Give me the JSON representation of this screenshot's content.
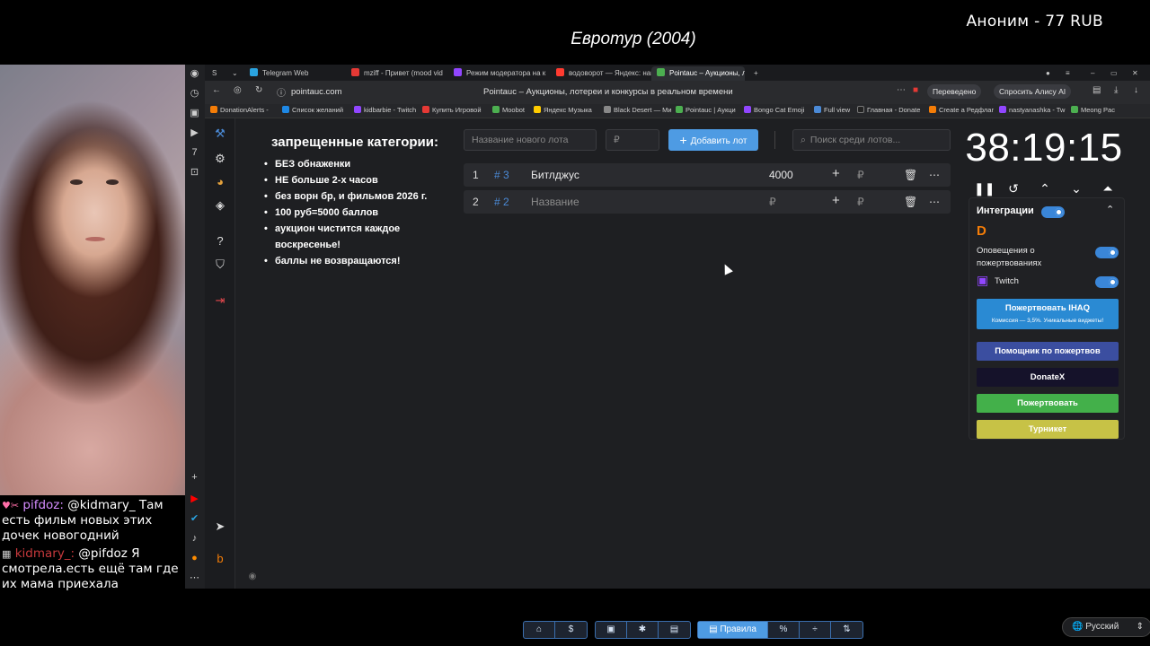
{
  "overlay": {
    "donor_line": "Аноним - 77 RUB",
    "video_title": "Евротур (2004)"
  },
  "chat": [
    {
      "user": "pifdoz:",
      "text": "@kidmary_ Там есть фильм новых этих дочек новогодний"
    },
    {
      "user": "kidmary_:",
      "text": "@pifdoz Я смотрела.есть ещё там где их мама приехала"
    }
  ],
  "browser": {
    "tabs": [
      {
        "label": "Telegram Web",
        "color": "#2aa3e0"
      },
      {
        "label": "mziff - Привет (mood vid",
        "color": "#e53935"
      },
      {
        "label": "Режим модератора на к",
        "color": "#9146ff"
      },
      {
        "label": "водоворот — Яндекс: нашл",
        "color": "#ff3b30"
      },
      {
        "label": "Pointauc – Аукционы, л",
        "color": "#4caf50"
      }
    ],
    "url": "pointauc.com",
    "page_title": "Pointauc – Аукционы, лотереи и конкурсы в реальном времени",
    "translated_label": "Переведено",
    "ask_alice_label": "Спросить Алису AI",
    "bookmarks": [
      {
        "label": "DonationAlerts -",
        "color": "#f57d07"
      },
      {
        "label": "Список желаний",
        "color": "#1e88e5"
      },
      {
        "label": "kidbarbie - Twitch",
        "color": "#9146ff"
      },
      {
        "label": "Купить Игровой",
        "color": "#e53935"
      },
      {
        "label": "Moobot",
        "color": "#4caf50"
      },
      {
        "label": "Яндекс Музыка",
        "color": "#ffcc00"
      },
      {
        "label": "Black Desert — Ми",
        "color": "#888888"
      },
      {
        "label": "Pointauc | Аукци",
        "color": "#4caf50"
      },
      {
        "label": "Bongo Cat Emoji",
        "color": "#9146ff"
      },
      {
        "label": "Full view",
        "color": "#4b8ad6"
      },
      {
        "label": "Главная - Donate",
        "color": "#222222"
      },
      {
        "label": "Create a Редфлаг",
        "color": "#f57d07"
      },
      {
        "label": "nastyanashka - Tw",
        "color": "#9146ff"
      },
      {
        "label": "Meong Pac",
        "color": "#4caf50"
      }
    ]
  },
  "rules": {
    "title": "запрещенные категории:",
    "items": [
      "БЕЗ обнаженки",
      "НЕ больше 2-х часов",
      "без ворн бр, и фильмов 2026 г.",
      "100 руб=5000 баллов",
      "аукцион чистится каждое воскресенье!",
      "баллы не возвращаются!"
    ]
  },
  "lot_form": {
    "name_placeholder": "Название нового лота",
    "amount_placeholder": "₽",
    "add_button": "Добавить лот",
    "search_placeholder": "Поиск среди лотов..."
  },
  "lots": [
    {
      "num": "1",
      "id": "# 3",
      "name": "Битлджус",
      "amount": "4000",
      "currency": "₽"
    },
    {
      "num": "2",
      "id": "# 2",
      "name": "Название",
      "amount": "₽",
      "currency": "₽"
    }
  ],
  "timer": {
    "value": "38:19:15"
  },
  "integrations": {
    "title": "Интеграции",
    "donation_alerts_label": "Оповещения о пожертвованиях",
    "twitch_label": "Twitch",
    "buttons": [
      {
        "label": "Пожертвовать IHAQ",
        "sub": "Комиссия — 3,5%. Уникальные виджеты!",
        "color": "#2a8ad3"
      },
      {
        "label": "Помощник по пожертвов",
        "color": "#3b4ea0"
      },
      {
        "label": "DonateX",
        "color": "#15122a"
      },
      {
        "label": "Пожертвовать",
        "color": "#43b04a"
      },
      {
        "label": "Турникет",
        "color": "#c7c246"
      }
    ]
  },
  "toolbar": {
    "rules_label": "Правила"
  },
  "language": {
    "label": "Русский"
  }
}
